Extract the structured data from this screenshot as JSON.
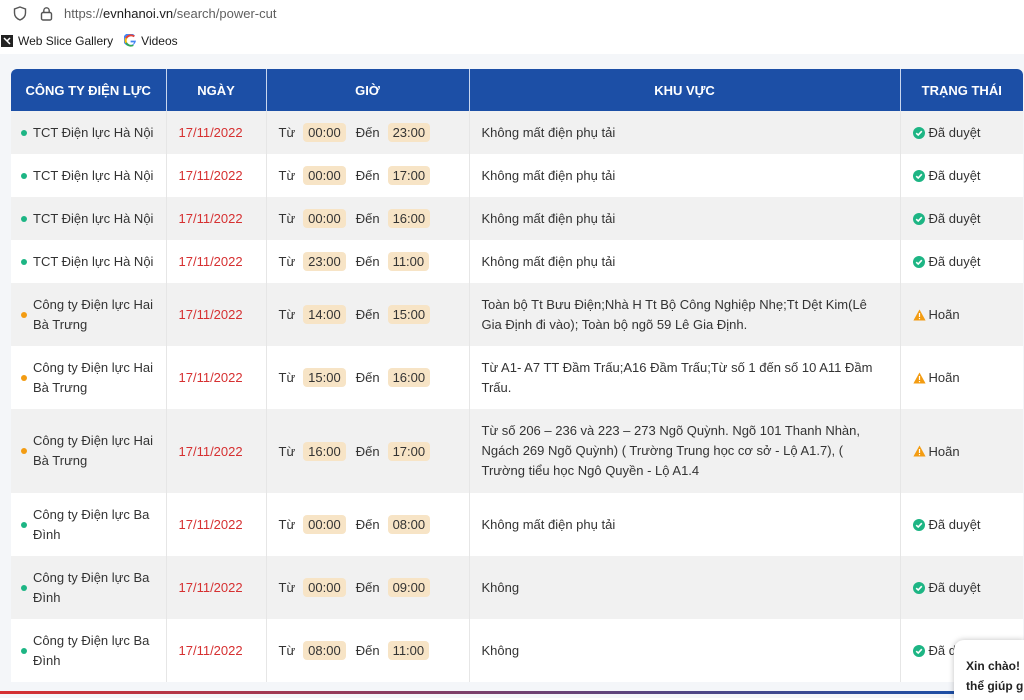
{
  "browser": {
    "url_prefix": "https://",
    "url_host": "evnhanoi.vn",
    "url_path": "/search/power-cut",
    "favorites": [
      {
        "label": "Web Slice Gallery",
        "icon": "web-slice-icon"
      },
      {
        "label": "Videos",
        "icon": "google-icon"
      }
    ]
  },
  "table": {
    "headers": {
      "company": "CÔNG TY ĐIỆN LỰC",
      "date": "NGÀY",
      "time": "GIỜ",
      "area": "KHU VỰC",
      "status": "TRẠNG THÁI"
    },
    "from_label": "Từ",
    "to_label": "Đến",
    "rows": [
      {
        "company": "TCT Điện lực Hà Nội",
        "company_color": "#1db584",
        "date": "17/11/2022",
        "from": "00:00",
        "to": "23:00",
        "area": "Không mất điện phụ tải",
        "status": "Đã duyệt",
        "status_type": "approved"
      },
      {
        "company": "TCT Điện lực Hà Nội",
        "company_color": "#1db584",
        "date": "17/11/2022",
        "from": "00:00",
        "to": "17:00",
        "area": "Không mất điện phụ tải",
        "status": "Đã duyệt",
        "status_type": "approved"
      },
      {
        "company": "TCT Điện lực Hà Nội",
        "company_color": "#1db584",
        "date": "17/11/2022",
        "from": "00:00",
        "to": "16:00",
        "area": "Không mất điện phụ tải",
        "status": "Đã duyệt",
        "status_type": "approved"
      },
      {
        "company": "TCT Điện lực Hà Nội",
        "company_color": "#1db584",
        "date": "17/11/2022",
        "from": "23:00",
        "to": "11:00",
        "area": "Không mất điện phụ tải",
        "status": "Đã duyệt",
        "status_type": "approved"
      },
      {
        "company": "Công ty Điện lực Hai Bà Trưng",
        "company_color": "#f39c12",
        "date": "17/11/2022",
        "from": "14:00",
        "to": "15:00",
        "area": "Toàn bộ Tt Bưu Điện;Nhà H Tt Bộ Công Nghiệp Nhẹ;Tt Dệt Kim(Lê Gia Định đi vào); Toàn bộ ngõ 59 Lê Gia Định.",
        "status": "Hoãn",
        "status_type": "postponed"
      },
      {
        "company": "Công ty Điện lực Hai Bà Trưng",
        "company_color": "#f39c12",
        "date": "17/11/2022",
        "from": "15:00",
        "to": "16:00",
        "area": "Từ A1- A7 TT Đầm Trấu;A16 Đầm Trấu;Từ số 1 đến số 10 A11 Đầm Trấu.",
        "status": "Hoãn",
        "status_type": "postponed"
      },
      {
        "company": "Công ty Điện lực Hai Bà Trưng",
        "company_color": "#f39c12",
        "date": "17/11/2022",
        "from": "16:00",
        "to": "17:00",
        "area": "Từ số 206 – 236 và 223 – 273 Ngõ Quỳnh. Ngõ 101 Thanh Nhàn, Ngách 269 Ngõ Quỳnh) ( Trường Trung học cơ sở - Lộ A1.7), ( Trường tiểu học Ngô Quyền - Lộ A1.4",
        "status": "Hoãn",
        "status_type": "postponed"
      },
      {
        "company": "Công ty Điện lực Ba Đình",
        "company_color": "#1db584",
        "date": "17/11/2022",
        "from": "00:00",
        "to": "08:00",
        "area": "Không mất điện phụ tải",
        "status": "Đã duyệt",
        "status_type": "approved"
      },
      {
        "company": "Công ty Điện lực Ba Đình",
        "company_color": "#1db584",
        "date": "17/11/2022",
        "from": "00:00",
        "to": "09:00",
        "area": "Không",
        "status": "Đã duyệt",
        "status_type": "approved"
      },
      {
        "company": "Công ty Điện lực Ba Đình",
        "company_color": "#1db584",
        "date": "17/11/2022",
        "from": "08:00",
        "to": "11:00",
        "area": "Không",
        "status": "Đã d",
        "status_type": "approved"
      }
    ]
  },
  "chat": {
    "line1": "Xin chào!",
    "line2": "thể giúp g"
  }
}
